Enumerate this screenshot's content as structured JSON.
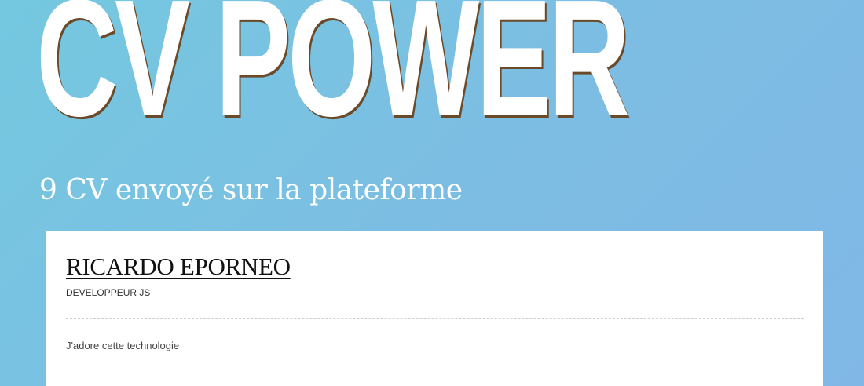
{
  "header": {
    "title": "CV POWER",
    "subtitle": "9 CV envoyé sur la plateforme"
  },
  "cards": [
    {
      "name": "RICARDO EPORNEO",
      "job": "DEVELOPPEUR JS",
      "description": "J'adore cette technologie"
    }
  ],
  "colors": {
    "background_start": "#74c8e0",
    "background_end": "#80b7e6",
    "title": "#ffffff",
    "title_shadow": "#6b4a2a",
    "card_background": "#ffffff"
  }
}
